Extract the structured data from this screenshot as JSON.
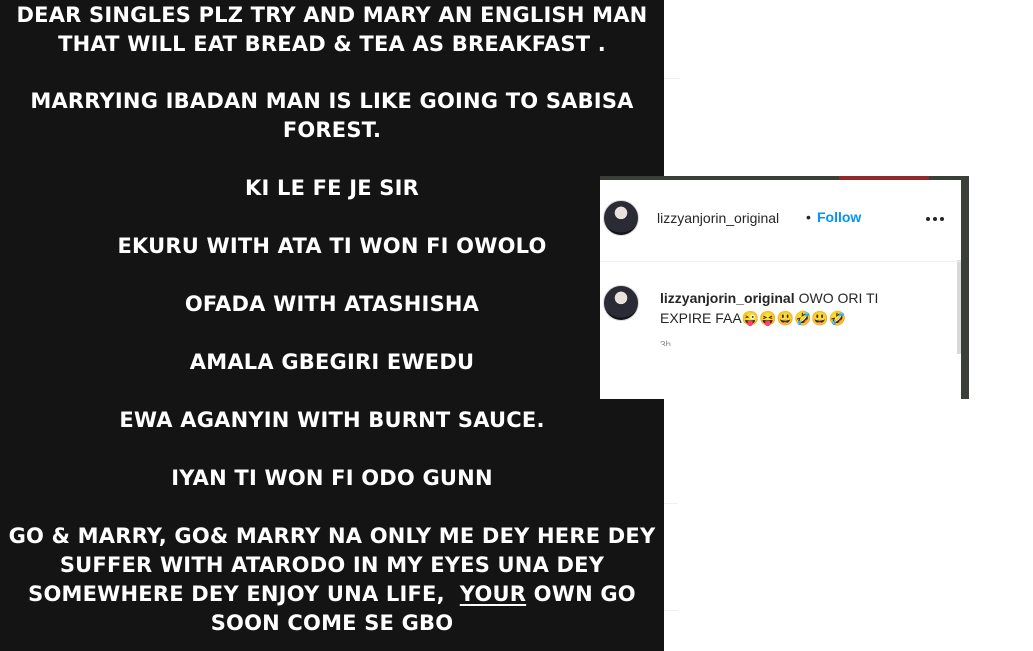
{
  "story": {
    "lines": [
      "DEAR SINGLES PLZ TRY AND MARY AN ENGLISH MAN",
      "THAT WILL EAT BREAD & TEA AS BREAKFAST .",
      "MARRYING IBADAN MAN IS LIKE GOING TO SABISA",
      "FOREST.",
      "KI LE FE JE SIR",
      "EKURU WITH ATA TI WON FI OWOLO",
      "OFADA WITH ATASHISHA",
      "AMALA GBEGIRI  EWEDU",
      "EWA AGANYIN  WITH BURNT SAUCE.",
      "IYAN TI WON FI ODO GUNN",
      "GO & MARRY, GO& MARRY NA ONLY ME DEY HERE DEY",
      "SUFFER WITH ATARODO IN MY EYES UNA DEY",
      "SOMEWHERE DEY ENJOY UNA LIFE,  ",
      "YOUR",
      " OWN GO",
      "SOON COME SE GBO"
    ]
  },
  "post": {
    "username": "lizzyanjorin_original",
    "dot": "•",
    "follow_label": "Follow",
    "more_icon": "more-horizontal-icon",
    "comment": {
      "username": "lizzyanjorin_original",
      "text": "OWO ORI TI EXPIRE FAA😜😝😃🤣😃🤣",
      "timestamp": "3h"
    }
  },
  "colors": {
    "story_bg": "#141414",
    "story_text": "#ffffff",
    "follow": "#0095f6"
  }
}
